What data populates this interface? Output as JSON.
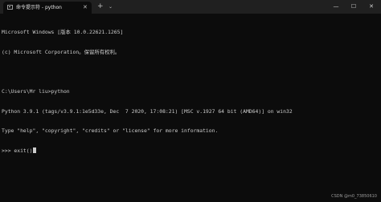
{
  "titlebar": {
    "tab_title": "命令提示符 - python",
    "tab_close_glyph": "✕",
    "new_tab_glyph": "+",
    "dropdown_glyph": "⌄",
    "minimize_glyph": "—",
    "maximize_glyph": "☐",
    "close_glyph": "✕"
  },
  "terminal": {
    "lines": [
      "Microsoft Windows [版本 10.0.22621.1265]",
      "(c) Microsoft Corporation。保留所有权利。",
      "",
      "C:\\Users\\Mr liu>python",
      "Python 3.9.1 (tags/v3.9.1:1e5d33e, Dec  7 2020, 17:08:21) [MSC v.1927 64 bit (AMD64)] on win32",
      "Type \"help\", \"copyright\", \"credits\" or \"license\" for more information.",
      ">>> exit()"
    ]
  },
  "watermark": "CSDN @m0_73850610",
  "colors": {
    "background": "#0c0c0c",
    "titlebar": "#202020",
    "text": "#cccccc"
  }
}
